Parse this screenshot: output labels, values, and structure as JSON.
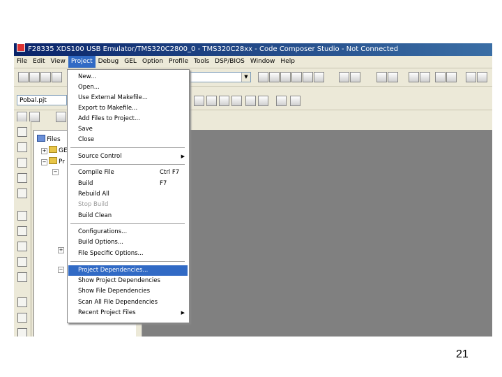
{
  "window": {
    "title": "F28335 XDS100 USB Emulator/TMS320C2800_0 - TMS320C28xx - Code Composer Studio - Not Connected"
  },
  "menubar": [
    "File",
    "Edit",
    "View",
    "Project",
    "Debug",
    "GEL",
    "Option",
    "Profile",
    "Tools",
    "DSP/BIOS",
    "Window",
    "Help"
  ],
  "toolbar": {
    "project_combo": "Pobal.pjt",
    "active_config_combo": ""
  },
  "tree": {
    "root_label": "Files",
    "node1": "GE",
    "node2": "Pr"
  },
  "project_menu": {
    "items": [
      "New...",
      "Open...",
      "Use External Makefile...",
      "Export to Makefile...",
      "Add Files to Project...",
      "Save",
      "Close",
      "Source Control",
      "Compile File",
      "Build",
      "Rebuild All",
      "Stop Build",
      "Build Clean",
      "Configurations...",
      "Build Options...",
      "File Specific Options...",
      "Project Dependencies...",
      "Show Project Dependencies",
      "Show File Dependencies",
      "Scan All File Dependencies",
      "Recent Project Files"
    ],
    "shortcuts": {
      "compile": "Ctrl F7",
      "build": "F7"
    }
  },
  "page_number": "21"
}
